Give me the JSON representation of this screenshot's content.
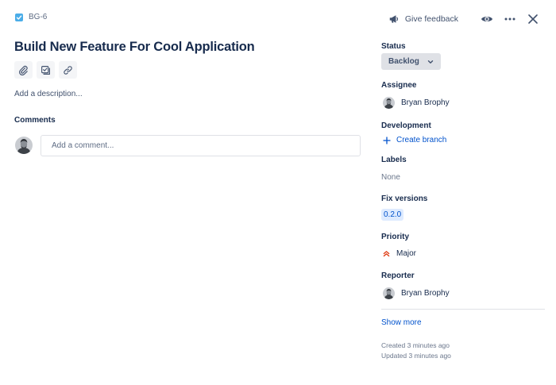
{
  "header": {
    "issue_key": "BG-6",
    "issue_type_icon": "task-check-icon",
    "feedback_label": "Give feedback",
    "feedback_icon": "megaphone-icon",
    "watch_icon": "eye-icon",
    "more_icon": "more-horizontal-icon",
    "close_icon": "close-icon"
  },
  "main": {
    "title": "Build New Feature For Cool Application",
    "toolbar_icons": [
      "paperclip-icon",
      "subtask-icon",
      "link-icon"
    ],
    "description_placeholder": "Add a description...",
    "comments_heading": "Comments",
    "comment_placeholder": "Add a comment..."
  },
  "sidebar": {
    "status": {
      "label": "Status",
      "value": "Backlog"
    },
    "assignee": {
      "label": "Assignee",
      "name": "Bryan Brophy"
    },
    "development": {
      "label": "Development",
      "action": "Create branch"
    },
    "labels": {
      "label": "Labels",
      "value": "None"
    },
    "fix_versions": {
      "label": "Fix versions",
      "value": "0.2.0"
    },
    "priority": {
      "label": "Priority",
      "value": "Major",
      "color": "#de350b"
    },
    "reporter": {
      "label": "Reporter",
      "name": "Bryan Brophy"
    },
    "show_more": "Show more",
    "created": "Created 3 minutes ago",
    "updated": "Updated 3 minutes ago"
  },
  "colors": {
    "accent": "#0052cc",
    "text": "#172b4d",
    "subtle": "#6b778c",
    "status_bg": "#dfe1e6",
    "version_bg": "#deebff",
    "task_icon": "#4bade8"
  }
}
